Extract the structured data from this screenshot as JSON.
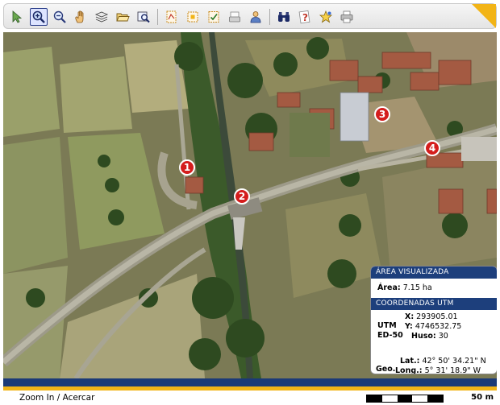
{
  "toolbar": {
    "tools": [
      {
        "name": "select-arrow-icon"
      },
      {
        "name": "zoom-in-icon",
        "active": true
      },
      {
        "name": "zoom-out-icon"
      },
      {
        "name": "pan-hand-icon"
      },
      {
        "name": "layers-icon"
      },
      {
        "name": "open-folder-icon"
      },
      {
        "name": "search-map-icon"
      },
      {
        "name": "measure-icon"
      },
      {
        "name": "select-area-icon"
      },
      {
        "name": "check-doc-icon"
      },
      {
        "name": "print-page-icon"
      },
      {
        "name": "user-icon"
      },
      {
        "name": "binoculars-icon"
      },
      {
        "name": "help-icon"
      },
      {
        "name": "star-icon"
      },
      {
        "name": "printer-icon"
      }
    ]
  },
  "map": {
    "markers": [
      "1",
      "2",
      "3",
      "4"
    ]
  },
  "info_panel": {
    "area_title": "ÁREA VISUALIZADA",
    "area_label": "Área:",
    "area_value": "7.15 ha",
    "utm_title": "COORDENADAS UTM",
    "utm_label": "UTM",
    "utm_datum": "ED-50",
    "x_label": "X:",
    "x_value": "293905.01",
    "y_label": "Y:",
    "y_value": "4746532.75",
    "huso_label": "Huso:",
    "huso_value": "30",
    "geo_label": "Geo.",
    "lat_label": "Lat.:",
    "lat_value": "42° 50' 34.21\" N",
    "long_label": "Long.:",
    "long_value": "5° 31' 18.9\" W"
  },
  "status": {
    "text": "Zoom In / Acercar",
    "scale_label": "50 m"
  },
  "colors": {
    "navy": "#1b3a77",
    "accent_yellow": "#f2b417",
    "marker_red": "#d41d1d"
  }
}
